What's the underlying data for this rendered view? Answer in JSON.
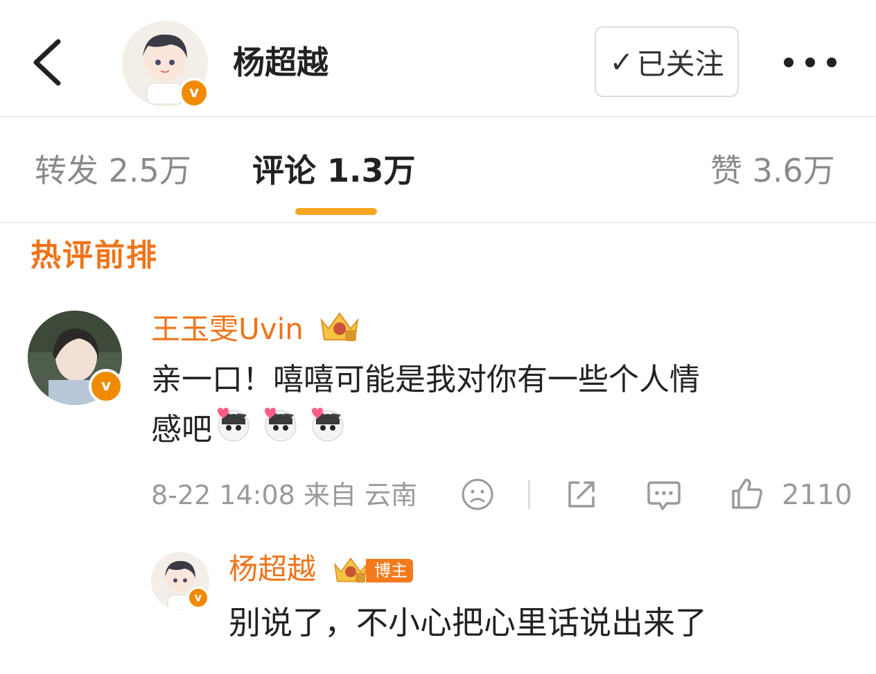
{
  "header": {
    "back_label": "",
    "title": "杨超越",
    "follow_label": "已关注",
    "follow_check": "✓"
  },
  "tabs": [
    {
      "label": "转发",
      "count": "2.5万"
    },
    {
      "label": "评论",
      "count": "1.3万"
    },
    {
      "label": "赞",
      "count": "3.6万"
    }
  ],
  "section": {
    "title": "热评前排"
  },
  "comment": {
    "author": "王玉雯Uvin",
    "text_line1": "亲一口！嘻嘻可能是我对你有一些个人情",
    "text_line2": "感吧",
    "date": "8-22 14:08",
    "location": "来自 云南",
    "like_count": "2110"
  },
  "reply": {
    "author": "杨超越",
    "owner_tag": "博主",
    "text": "别说了，不小心把心里话说出来了"
  },
  "colors": {
    "accent_orange": "#f07318",
    "tab_indicator": "#f5a623",
    "verified_badge": "#f08a00",
    "muted_text": "#9a9a9a"
  },
  "icons": [
    "back-chevron-icon",
    "verified-v-icon",
    "checkmark-icon",
    "more-dots-icon",
    "crown-level-icon",
    "cat-heart-emoji-icon",
    "sad-face-icon",
    "share-icon",
    "comment-bubble-icon",
    "thumbs-up-icon"
  ]
}
